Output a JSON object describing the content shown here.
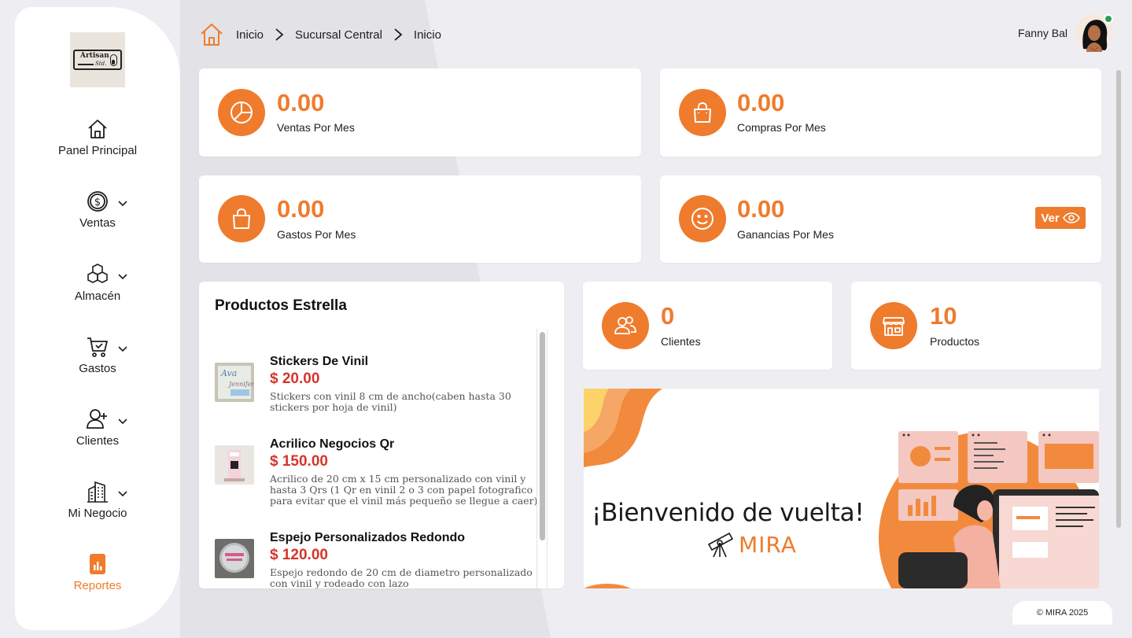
{
  "brand": {
    "logo_text": "Artisan",
    "logo_subtext": "Std.",
    "accent_color": "#ef7b2d",
    "price_color": "#d6352a"
  },
  "sidebar": {
    "items": [
      {
        "label": "Panel Principal",
        "icon": "home-icon",
        "has_dropdown": false
      },
      {
        "label": "Ventas",
        "icon": "dollar-circle-icon",
        "has_dropdown": true
      },
      {
        "label": "Almacén",
        "icon": "boxes-icon",
        "has_dropdown": true
      },
      {
        "label": "Gastos",
        "icon": "cart-icon",
        "has_dropdown": true
      },
      {
        "label": "Clientes",
        "icon": "user-plus-icon",
        "has_dropdown": true
      },
      {
        "label": "Mi Negocio",
        "icon": "buildings-icon",
        "has_dropdown": true
      },
      {
        "label": "Reportes",
        "icon": "report-icon",
        "has_dropdown": false,
        "active": true
      }
    ]
  },
  "header": {
    "breadcrumb": [
      "Inicio",
      "Sucursal Central",
      "Inicio"
    ],
    "user_name": "Fanny Bal",
    "user_status": "online"
  },
  "stats": [
    {
      "value": "0.00",
      "label": "Ventas Por Mes",
      "icon": "pie-chart-icon"
    },
    {
      "value": "0.00",
      "label": "Compras Por Mes",
      "icon": "shopping-bag-icon"
    },
    {
      "value": "0.00",
      "label": "Gastos Por Mes",
      "icon": "shopping-bag-icon"
    },
    {
      "value": "0.00",
      "label": "Ganancias Por Mes",
      "icon": "smile-icon",
      "action_label": "Ver"
    }
  ],
  "counters": [
    {
      "value": "0",
      "label": "Clientes",
      "icon": "users-icon"
    },
    {
      "value": "10",
      "label": "Productos",
      "icon": "store-icon"
    }
  ],
  "featured": {
    "title": "Productos Estrella",
    "products": [
      {
        "name": "Stickers De Vinil",
        "price": "$ 20.00",
        "description": "Stickers con vinil 8 cm de ancho(caben hasta 30 stickers por hoja de vinil)"
      },
      {
        "name": "Acrilico Negocios Qr",
        "price": "$ 150.00",
        "description": "Acrilico de 20 cm x 15 cm personalizado con vinil y hasta 3 Qrs (1 Qr en vinil 2 o 3 con papel fotografico para evitar que el vinil más pequeño se llegue a caer)"
      },
      {
        "name": "Espejo Personalizados Redondo",
        "price": "$ 120.00",
        "description": "Espejo redondo de 20 cm de diametro personalizado con vinil y rodeado con lazo"
      }
    ]
  },
  "banner": {
    "welcome": "¡Bienvenido de vuelta!",
    "brand": "MIRA"
  },
  "footer": {
    "copyright": "© MIRA 2025"
  }
}
